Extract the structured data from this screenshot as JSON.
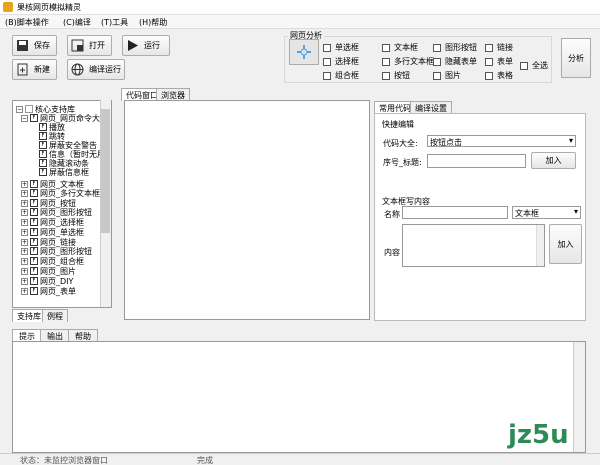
{
  "app": {
    "title": "果核网页模拟精灵"
  },
  "menu": [
    "(B)脚本操作",
    "(C)编译",
    "(T)工具",
    "(H)帮助"
  ],
  "toolbar": {
    "save": "保存",
    "open": "打开",
    "run": "运行",
    "new": "新建",
    "compile_run": "编译运行"
  },
  "analyze": {
    "title": "网页分析",
    "checkboxes": [
      "单选框",
      "文本框",
      "图形按钮",
      "链接",
      "选择框",
      "多行文本框",
      "隐藏表单",
      "表单",
      "组合框",
      "按钮",
      "图片",
      "表格"
    ],
    "select_all": "全选",
    "button": "分析"
  },
  "tree": {
    "root": "核心支持库",
    "items": [
      "网页_网页命令大全",
      "播放",
      "跳转",
      "屏蔽安全警告",
      "信息（暂时无用",
      "隐藏滚动条",
      "屏蔽信息框",
      "网页_文本框",
      "网页_多行文本框",
      "网页_按钮",
      "网页_图形按钮",
      "网页_选择框",
      "网页_单选框",
      "网页_链接",
      "网页_图形按钮",
      "网页_组合框",
      "网页_图片",
      "网页_DIY",
      "网页_表单"
    ]
  },
  "left_tabs": [
    "支持库",
    "例程"
  ],
  "center_tabs": [
    "代码窗口",
    "浏览器"
  ],
  "right_tabs": [
    "常用代码",
    "编译设置"
  ],
  "quick_edit": {
    "title": "快捷编辑",
    "code_label": "代码大全:",
    "code_value": "按钮点击",
    "index_label": "序号_标题:",
    "add1": "加入",
    "textarea_title": "文本框写内容",
    "name_label": "名称",
    "name_type": "文本框",
    "content_label": "内容",
    "add2": "加入"
  },
  "bottom_tabs": [
    "提示",
    "输出",
    "帮助"
  ],
  "status": {
    "left": "状态：未监控浏览器窗口",
    "right": "完成"
  },
  "watermark": "jz5u"
}
